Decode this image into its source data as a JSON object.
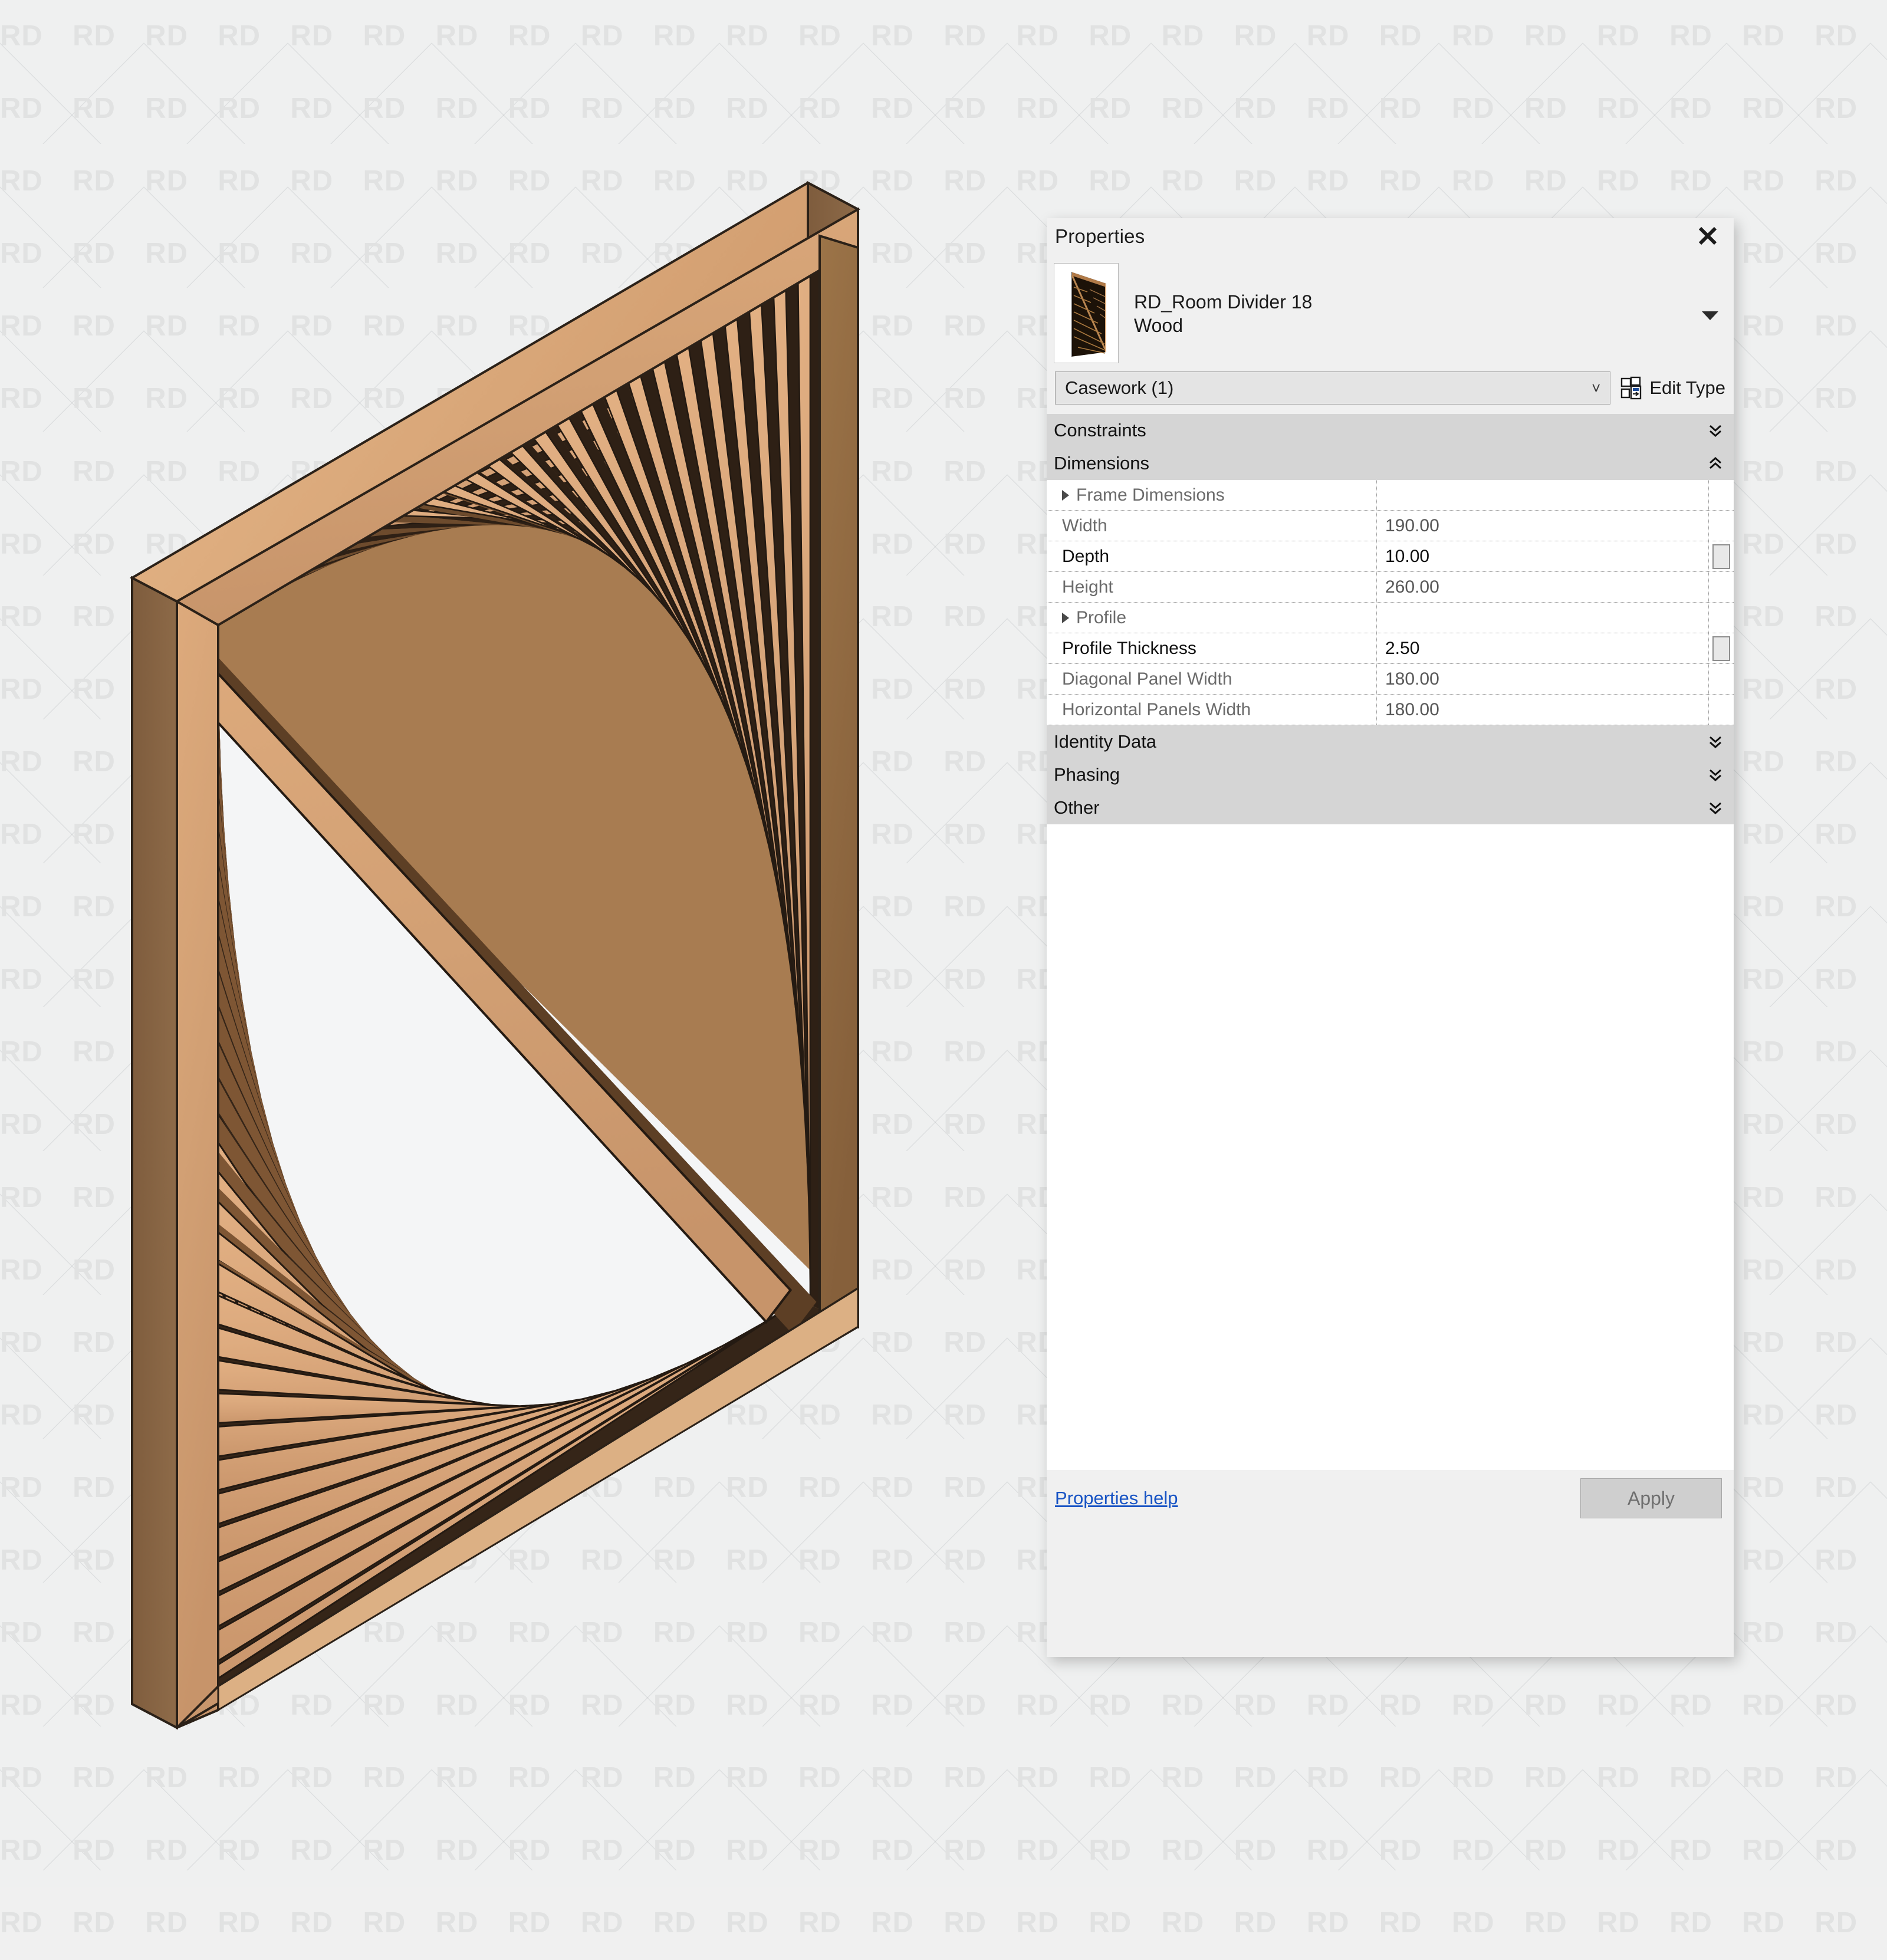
{
  "background": {
    "watermark_text": "RD",
    "page_bg": "#eff0f0"
  },
  "model": {
    "name": "room-divider-3d-view",
    "description": "RD_Room Divider 18 Wood - isometric wood slat screen",
    "frame_color": "#c9976a",
    "slat_color": "#d9a877",
    "shadow_color": "#8a6440"
  },
  "panel": {
    "title": "Properties",
    "close_icon": "close-icon",
    "type_name_line1": "RD_Room Divider 18",
    "type_name_line2": "Wood",
    "caret_icon": "chevron-down-icon",
    "category_selector": {
      "value": "Casework (1)",
      "caret": "chevron-down-icon"
    },
    "edit_type": {
      "label": "Edit Type",
      "icon": "edit-type-icon"
    },
    "sections": [
      {
        "label": "Constraints",
        "state": "collapsed",
        "icon": "chevron-double-down-icon"
      },
      {
        "label": "Dimensions",
        "state": "expanded",
        "icon": "chevron-double-up-icon"
      }
    ],
    "dimensions_rows": [
      {
        "key": "Frame Dimensions",
        "value": "",
        "group": true,
        "bold": false,
        "button": false,
        "expander": "triangle-right-icon"
      },
      {
        "key": "Width",
        "value": "190.00",
        "group": true,
        "bold": false,
        "button": false,
        "expander": ""
      },
      {
        "key": "Depth",
        "value": "10.00",
        "group": true,
        "bold": true,
        "button": true,
        "expander": ""
      },
      {
        "key": "Height",
        "value": "260.00",
        "group": true,
        "bold": false,
        "button": false,
        "expander": ""
      },
      {
        "key": "Profile",
        "value": "",
        "group": true,
        "bold": false,
        "button": false,
        "expander": "triangle-right-icon"
      },
      {
        "key": "Profile Thickness",
        "value": "2.50",
        "group": true,
        "bold": true,
        "button": true,
        "expander": ""
      },
      {
        "key": "Diagonal Panel Width",
        "value": "180.00",
        "group": true,
        "bold": false,
        "button": false,
        "expander": ""
      },
      {
        "key": "Horizontal Panels Width",
        "value": "180.00",
        "group": true,
        "bold": false,
        "button": false,
        "expander": ""
      }
    ],
    "bottom_sections": [
      {
        "label": "Identity Data",
        "state": "collapsed",
        "icon": "chevron-double-down-icon"
      },
      {
        "label": "Phasing",
        "state": "collapsed",
        "icon": "chevron-double-down-icon"
      },
      {
        "label": "Other",
        "state": "collapsed",
        "icon": "chevron-double-down-icon"
      }
    ],
    "footer": {
      "help_link": "Properties help",
      "apply_label": "Apply"
    },
    "colors": {
      "panel_bg": "#f0f0f0",
      "section_header_bg": "#d5d5d5",
      "table_bg": "#ffffff",
      "link": "#1753c4",
      "apply_bg": "#cfcfcf"
    }
  }
}
